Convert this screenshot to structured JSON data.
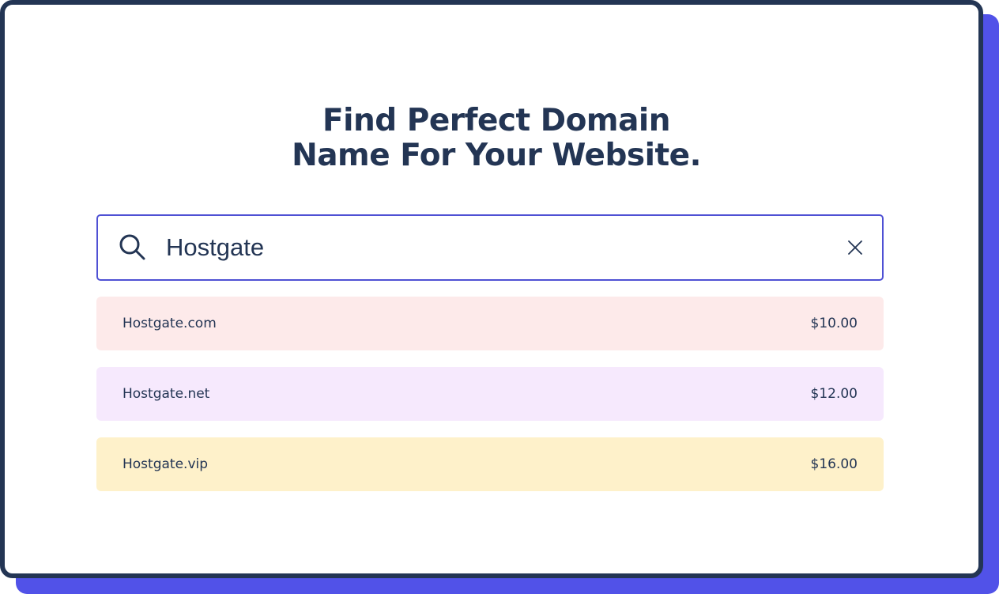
{
  "headline": {
    "line1": "Find Perfect Domain",
    "line2": "Name For Your Website."
  },
  "search": {
    "value": "Hostgate",
    "icon": "search-icon",
    "clear_icon": "close-icon"
  },
  "results": [
    {
      "domain": "Hostgate.com",
      "price": "$10.00",
      "color": "#fdeaea"
    },
    {
      "domain": "Hostgate.net",
      "price": "$12.00",
      "color": "#f6e9fd"
    },
    {
      "domain": "Hostgate.vip",
      "price": "$16.00",
      "color": "#fef1ca"
    }
  ],
  "colors": {
    "text": "#233554",
    "accent": "#5152e8",
    "input_border": "#4f51d4"
  }
}
